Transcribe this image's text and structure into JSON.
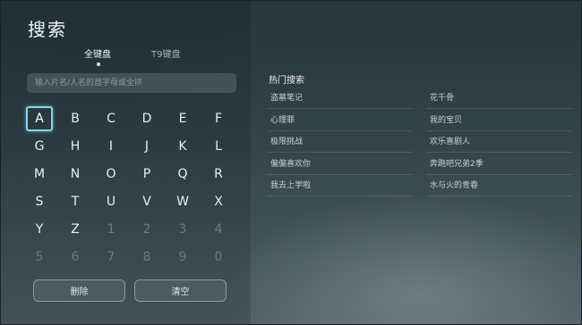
{
  "header": {
    "title": "搜索"
  },
  "tabs": [
    {
      "label": "全键盘",
      "active": true
    },
    {
      "label": "T9键盘",
      "active": false
    }
  ],
  "search": {
    "placeholder": "输入片名/人名的首字母或全拼"
  },
  "keyboard": {
    "selected": "A",
    "rows": [
      [
        "A",
        "B",
        "C",
        "D",
        "E",
        "F"
      ],
      [
        "G",
        "H",
        "I",
        "J",
        "K",
        "L"
      ],
      [
        "M",
        "N",
        "O",
        "P",
        "Q",
        "R"
      ],
      [
        "S",
        "T",
        "U",
        "V",
        "W",
        "X"
      ],
      [
        "Y",
        "Z",
        "1",
        "2",
        "3",
        "4"
      ],
      [
        "5",
        "6",
        "7",
        "8",
        "9",
        "0"
      ]
    ],
    "dim_after_index": 2,
    "dim_from_row": 4
  },
  "actions": {
    "delete_label": "删除",
    "clear_label": "清空"
  },
  "hot_search": {
    "title": "热门搜索",
    "items": [
      "盗墓笔记",
      "花千骨",
      "心理罪",
      "我的宝贝",
      "极限挑战",
      "欢乐喜剧人",
      "偏偏喜欢你",
      "奔跑吧兄弟2季",
      "我去上学啦",
      "水与火的青春"
    ]
  },
  "colors": {
    "accent": "#8fd3e8"
  }
}
